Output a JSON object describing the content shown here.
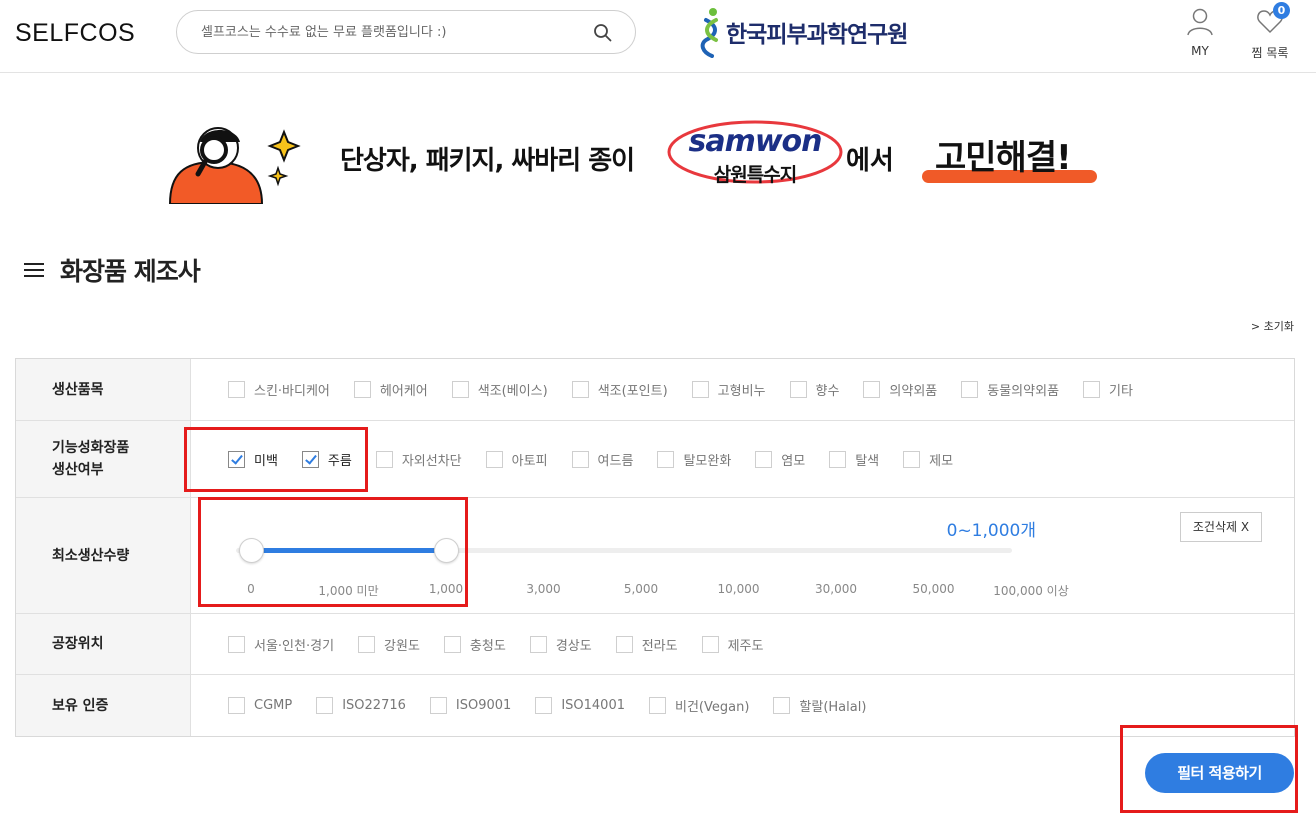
{
  "header": {
    "logo": "SELFCOS",
    "search_placeholder": "셀프코스는 수수료 없는 무료 플랫폼입니다 :)",
    "center_logo_text": "한국피부과학연구원",
    "my_label": "MY",
    "wishlist_label": "찜 목록",
    "wishlist_count": "0"
  },
  "banner": {
    "text1": "단상자, 패키지, 싸바리 종이",
    "brand_en": "samwon",
    "brand_ko": "삼원특수지",
    "text2": "에서",
    "text3": "고민해결!"
  },
  "page": {
    "title": "화장품 제조사",
    "reset_label": "> 초기화"
  },
  "filters": {
    "product": {
      "label": "생산품목",
      "options": [
        "스킨·바디케어",
        "헤어케어",
        "색조(베이스)",
        "색조(포인트)",
        "고형비누",
        "향수",
        "의약외품",
        "동물의약외품",
        "기타"
      ]
    },
    "functional": {
      "label_line1": "기능성화장품",
      "label_line2": "생산여부",
      "options": [
        "미백",
        "주름",
        "자외선차단",
        "아토피",
        "여드름",
        "탈모완화",
        "염모",
        "탈색",
        "제모"
      ],
      "checked": [
        "미백",
        "주름"
      ]
    },
    "min_qty": {
      "label": "최소생산수량",
      "value_text": "0~1,000개",
      "cond_delete": "조건삭제 X",
      "ticks": [
        "0",
        "1,000 미만",
        "1,000",
        "3,000",
        "5,000",
        "10,000",
        "30,000",
        "50,000",
        "100,000 이상"
      ],
      "range_index": [
        0,
        2
      ]
    },
    "location": {
      "label": "공장위치",
      "options": [
        "서울·인천·경기",
        "강원도",
        "충청도",
        "경상도",
        "전라도",
        "제주도"
      ]
    },
    "cert": {
      "label": "보유 인증",
      "options": [
        "CGMP",
        "ISO22716",
        "ISO9001",
        "ISO14001",
        "비건(Vegan)",
        "할랄(Halal)"
      ]
    }
  },
  "apply_label": "필터 적용하기",
  "colors": {
    "accent": "#2f7de1",
    "highlight": "#e51b1b",
    "banner_orange": "#f05a28"
  }
}
